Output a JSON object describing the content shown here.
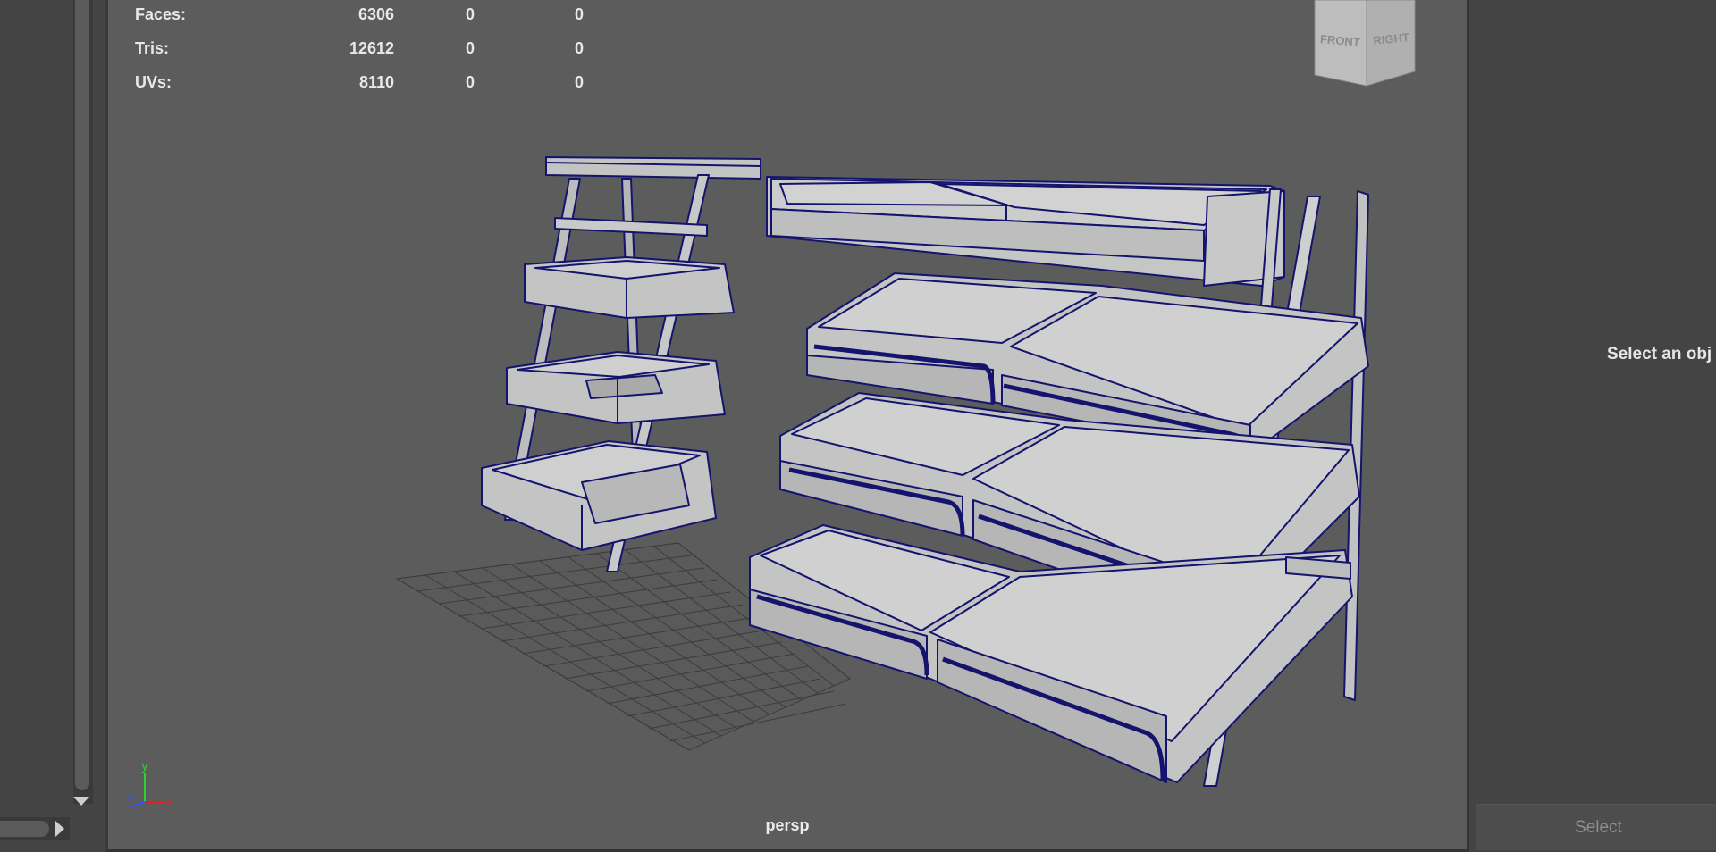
{
  "hud": {
    "rows": [
      {
        "label": "Faces:",
        "value": "6306",
        "c2": "0",
        "c3": "0"
      },
      {
        "label": "Tris:",
        "value": "12612",
        "c2": "0",
        "c3": "0"
      },
      {
        "label": "UVs:",
        "value": "8110",
        "c2": "0",
        "c3": "0"
      }
    ]
  },
  "viewcube": {
    "front": "FRONT",
    "right": "RIGHT"
  },
  "axis": {
    "y": "y",
    "x": "x",
    "z": "z"
  },
  "viewport": {
    "camera": "persp"
  },
  "attribute_panel": {
    "message": "Select an obj",
    "button": "Select"
  },
  "colors": {
    "viewport_bg": "#5c5c5c",
    "panel_bg": "#444444",
    "wireframe": "#14146e",
    "shaded": "#c4c4c4",
    "axis_x": "#e02020",
    "axis_y": "#30d030",
    "axis_z": "#3050ff"
  }
}
